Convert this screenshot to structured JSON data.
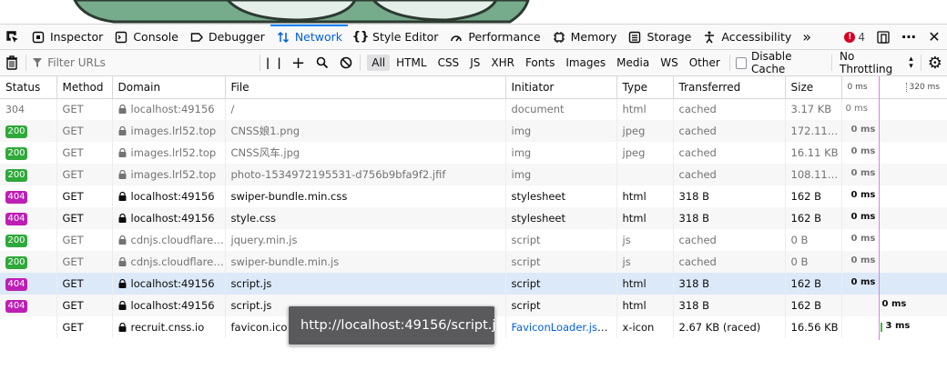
{
  "toolbox": {
    "tabs": [
      {
        "label": "Inspector",
        "icon": "inspector-icon",
        "selected": false
      },
      {
        "label": "Console",
        "icon": "console-icon",
        "selected": false
      },
      {
        "label": "Debugger",
        "icon": "debugger-icon",
        "selected": false
      },
      {
        "label": "Network",
        "icon": "network-icon",
        "selected": true
      },
      {
        "label": "Style Editor",
        "icon": "style-editor-icon",
        "selected": false
      },
      {
        "label": "Performance",
        "icon": "performance-icon",
        "selected": false
      },
      {
        "label": "Memory",
        "icon": "memory-icon",
        "selected": false
      },
      {
        "label": "Storage",
        "icon": "storage-icon",
        "selected": false
      },
      {
        "label": "Accessibility",
        "icon": "accessibility-icon",
        "selected": false
      }
    ],
    "error_count": "4"
  },
  "filterbar": {
    "filter_placeholder": "Filter URLs",
    "types": [
      "All",
      "HTML",
      "CSS",
      "JS",
      "XHR",
      "Fonts",
      "Images",
      "Media",
      "WS",
      "Other"
    ],
    "active_type": "All",
    "disable_cache_label": "Disable Cache",
    "throttling_label": "No Throttling"
  },
  "columns": {
    "status": "Status",
    "method": "Method",
    "domain": "Domain",
    "file": "File",
    "initiator": "Initiator",
    "type": "Type",
    "transferred": "Transferred",
    "size": "Size",
    "wf_start": "0 ms",
    "wf_end": "320 ms"
  },
  "requests": [
    {
      "status": "304",
      "method": "GET",
      "domain": "localhost:49156",
      "file": "/",
      "initiator": "document",
      "type": "html",
      "transferred": "cached",
      "size": "3.17 KB",
      "timing": "0 ms"
    },
    {
      "status": "200",
      "method": "GET",
      "domain": "images.lrl52.top",
      "file": "CNSS娘1.png",
      "initiator": "img",
      "type": "jpeg",
      "transferred": "cached",
      "size": "172.11 KB",
      "timing": "0 ms"
    },
    {
      "status": "200",
      "method": "GET",
      "domain": "images.lrl52.top",
      "file": "CNSS风车.jpg",
      "initiator": "img",
      "type": "jpeg",
      "transferred": "cached",
      "size": "16.11 KB",
      "timing": "0 ms"
    },
    {
      "status": "200",
      "method": "GET",
      "domain": "images.lrl52.top",
      "file": "photo-1534972195531-d756b9bfa9f2.jfif",
      "initiator": "img",
      "type": "",
      "transferred": "cached",
      "size": "108.11 KB",
      "timing": "0 ms"
    },
    {
      "status": "404",
      "method": "GET",
      "domain": "localhost:49156",
      "file": "swiper-bundle.min.css",
      "initiator": "stylesheet",
      "type": "html",
      "transferred": "318 B",
      "size": "162 B",
      "timing": "0 ms"
    },
    {
      "status": "404",
      "method": "GET",
      "domain": "localhost:49156",
      "file": "style.css",
      "initiator": "stylesheet",
      "type": "html",
      "transferred": "318 B",
      "size": "162 B",
      "timing": "0 ms"
    },
    {
      "status": "200",
      "method": "GET",
      "domain": "cdnjs.cloudflare.c...",
      "file": "jquery.min.js",
      "initiator": "script",
      "type": "js",
      "transferred": "cached",
      "size": "0 B",
      "timing": "0 ms"
    },
    {
      "status": "200",
      "method": "GET",
      "domain": "cdnjs.cloudflare.c...",
      "file": "swiper-bundle.min.js",
      "initiator": "script",
      "type": "js",
      "transferred": "cached",
      "size": "0 B",
      "timing": "0 ms"
    },
    {
      "status": "404",
      "method": "GET",
      "domain": "localhost:49156",
      "file": "script.js",
      "initiator": "script",
      "type": "html",
      "transferred": "318 B",
      "size": "162 B",
      "timing": "0 ms"
    },
    {
      "status": "404",
      "method": "GET",
      "domain": "localhost:49156",
      "file": "script.js",
      "initiator": "script",
      "type": "html",
      "transferred": "318 B",
      "size": "162 B",
      "timing": "0 ms"
    },
    {
      "status": "",
      "method": "GET",
      "domain": "recruit.cnss.io",
      "file": "favicon.ico",
      "initiator": "FaviconLoader.jsm:1...",
      "type": "x-icon",
      "transferred": "2.67 KB (raced)",
      "size": "16.56 KB",
      "timing": "3 ms"
    }
  ],
  "tooltip": "http://localhost:49156/script.js",
  "colors": {
    "accent": "#0a84ff",
    "status_200": "#30a93b",
    "status_404": "#bd1fb4",
    "waterfall_line": "#e37af2"
  }
}
